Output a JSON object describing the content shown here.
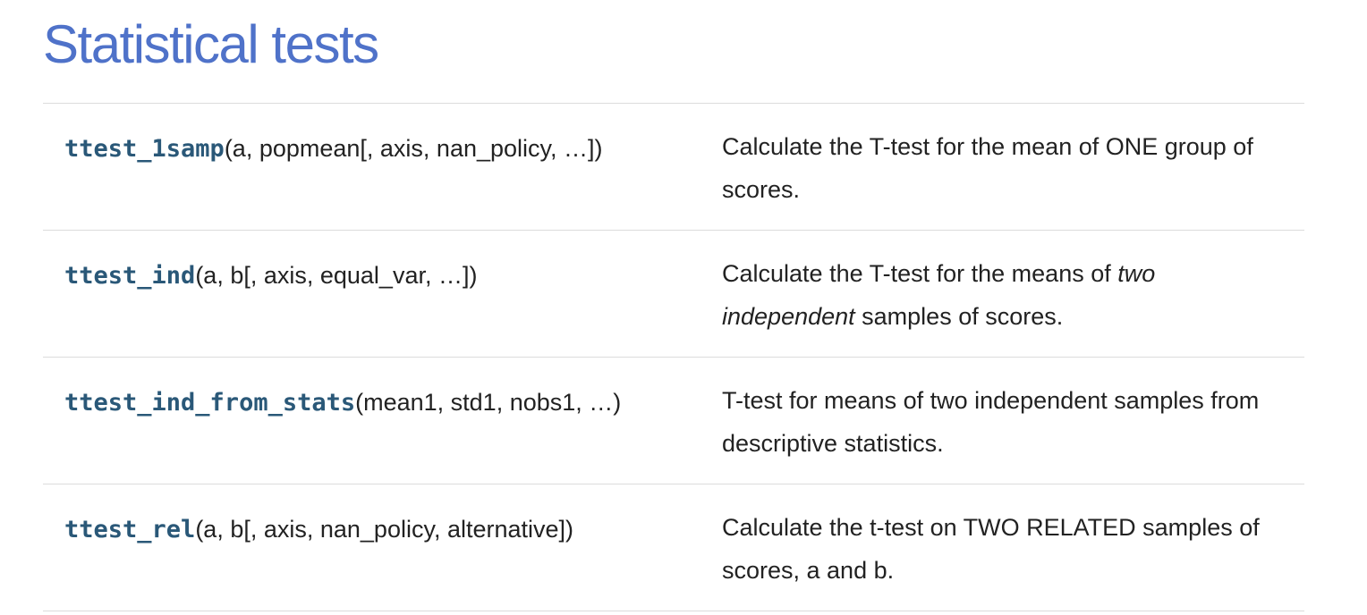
{
  "page": {
    "title": "Statistical tests"
  },
  "colors": {
    "title": "#4f72c9",
    "function_name": "#2a5878",
    "text": "#222222",
    "row_divider": "#dcdcdc"
  },
  "rows": [
    {
      "name": "ttest_1samp",
      "args": "(a, popmean[, axis, nan_policy, …])",
      "description": {
        "before": "Calculate the T-test for the mean of ONE group of scores.",
        "emphasis": "",
        "after": ""
      }
    },
    {
      "name": "ttest_ind",
      "args": "(a, b[, axis, equal_var, …])",
      "description": {
        "before": "Calculate the T-test for the means of ",
        "emphasis": "two independent",
        "after": " samples of scores."
      }
    },
    {
      "name": "ttest_ind_from_stats",
      "args": "(mean1, std1, nobs1, …)",
      "description": {
        "before": "T-test for means of two independent samples from descriptive statistics.",
        "emphasis": "",
        "after": ""
      }
    },
    {
      "name": "ttest_rel",
      "args": "(a, b[, axis, nan_policy, alternative])",
      "description": {
        "before": "Calculate the t-test on TWO RELATED samples of scores, a and b.",
        "emphasis": "",
        "after": ""
      }
    }
  ]
}
